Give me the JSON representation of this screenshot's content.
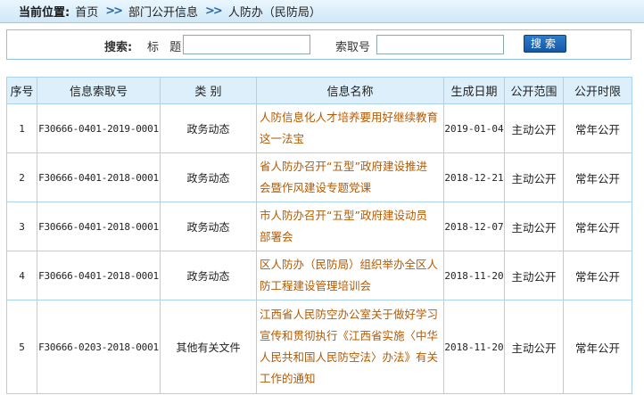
{
  "breadcrumb": {
    "label": "当前位置:",
    "items": [
      "首页",
      "部门公开信息",
      "人防办（民防局）"
    ],
    "separator": ">>"
  },
  "search": {
    "title": "搜索:",
    "field1_label": "标 题",
    "field1_value": "",
    "field2_label": "索取号",
    "field2_value": "",
    "button_label": "搜索"
  },
  "table": {
    "headers": [
      "序号",
      "信息索取号",
      "类 别",
      "信息名称",
      "生成日期",
      "公开范围",
      "公开时限"
    ],
    "rows": [
      {
        "no": "1",
        "code": "F30666-0401-2019-0001",
        "type": "政务动态",
        "name": "人防信息化人才培养要用好继续教育这一法宝",
        "date": "2019-01-04",
        "scope": "主动公开",
        "term": "常年公开"
      },
      {
        "no": "2",
        "code": "F30666-0401-2018-0001",
        "type": "政务动态",
        "name": "省人防办召开“五型”政府建设推进会暨作风建设专题党课",
        "date": "2018-12-21",
        "scope": "主动公开",
        "term": "常年公开"
      },
      {
        "no": "3",
        "code": "F30666-0401-2018-0001",
        "type": "政务动态",
        "name": "市人防办召开“五型”政府建设动员部署会",
        "date": "2018-12-07",
        "scope": "主动公开",
        "term": "常年公开"
      },
      {
        "no": "4",
        "code": "F30666-0401-2018-0001",
        "type": "政务动态",
        "name": "区人防办（民防局）组织举办全区人防工程建设管理培训会",
        "date": "2018-11-20",
        "scope": "主动公开",
        "term": "常年公开"
      },
      {
        "no": "5",
        "code": "F30666-0203-2018-0001",
        "type": "其他有关文件",
        "name": "江西省人民防空办公室关于做好学习宣传和贯彻执行《江西省实施〈中华人民共和国人民防空法〉办法》有关工作的通知",
        "date": "2018-11-20",
        "scope": "主动公开",
        "term": "常年公开"
      }
    ]
  },
  "colors": {
    "link": "#b45a00",
    "header_bg": "#dceffb",
    "border": "#a9d2ee",
    "button": "#1558a8"
  }
}
